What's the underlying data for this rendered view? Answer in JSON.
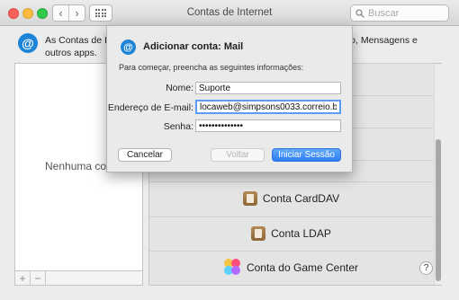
{
  "window": {
    "title": "Contas de Internet"
  },
  "toolbar": {
    "search_placeholder": "Buscar",
    "back_glyph": "‹",
    "forward_glyph": "›"
  },
  "header": {
    "icon_glyph": "@",
    "text_part1": "As Contas de Int",
    "text_part2": "dário, Mensagens e",
    "text_part3": "outros apps."
  },
  "accounts_list": {
    "empty_label": "Nenhuma con",
    "add_glyph": "+",
    "remove_glyph": "−"
  },
  "providers": [
    {
      "label": "Conta CardDAV",
      "icon": "carddav-icon"
    },
    {
      "label": "Conta LDAP",
      "icon": "ldap-icon"
    },
    {
      "label": "Conta do Game Center",
      "icon": "game-center-icon"
    }
  ],
  "help_glyph": "?",
  "dialog": {
    "icon_glyph": "@",
    "title": "Adicionar conta: Mail",
    "intro": "Para começar, preencha as seguintes informações:",
    "fields": {
      "name": {
        "label": "Nome:",
        "value": "Suporte"
      },
      "email": {
        "label": "Endereço de E-mail:",
        "value": "locaweb@simpsons0033.correio.biz"
      },
      "password": {
        "label": "Senha:",
        "value": "secretpass1234"
      }
    },
    "buttons": {
      "cancel": "Cancelar",
      "back": "Voltar",
      "sign_in": "Iniciar Sessão"
    }
  },
  "colors": {
    "accent": "#2f7ef3",
    "at_icon": "#1e84d8",
    "close": "#fc605c",
    "minimize": "#fdbc40",
    "zoom": "#34c84a"
  }
}
